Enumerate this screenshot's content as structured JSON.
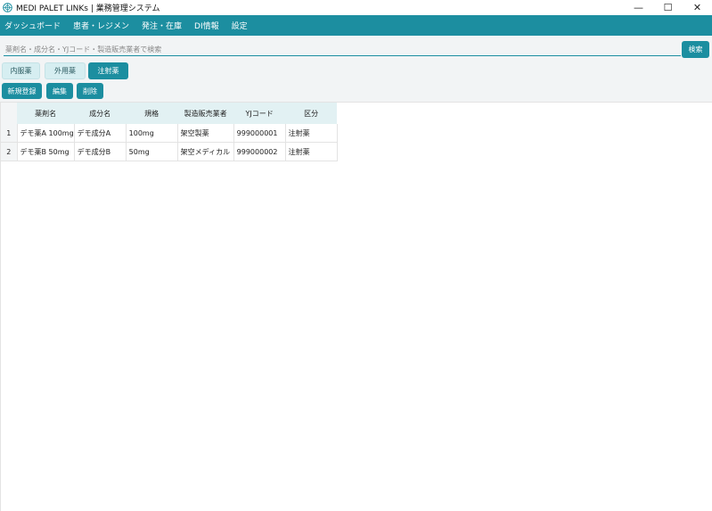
{
  "window": {
    "title": "MEDI PALET LINKs | 業務管理システム",
    "controls": [
      "—",
      "☐",
      "✕"
    ]
  },
  "menu": [
    {
      "label": "ダッシュボード"
    },
    {
      "label": "患者・レジメン"
    },
    {
      "label": "発注・在庫"
    },
    {
      "label": "DI情報"
    },
    {
      "label": "設定"
    }
  ],
  "search": {
    "placeholder": "薬剤名・成分名・YJコード・製造販売業者で検索",
    "value": "",
    "button_label": "検索"
  },
  "categories": [
    {
      "label": "内服薬",
      "active": false
    },
    {
      "label": "外用薬",
      "active": false
    },
    {
      "label": "注射薬",
      "active": true
    }
  ],
  "actions": {
    "new_label": "新規登録",
    "edit_label": "編集",
    "delete_label": "削除"
  },
  "table": {
    "headers": [
      "薬剤名",
      "成分名",
      "規格",
      "製造販売業者",
      "YJコード",
      "区分"
    ],
    "rows": [
      {
        "num": "1",
        "cells": [
          "デモ薬A 100mg",
          "デモ成分A",
          "100mg",
          "架空製薬",
          "999000001",
          "注射薬"
        ]
      },
      {
        "num": "2",
        "cells": [
          "デモ薬B 50mg",
          "デモ成分B",
          "50mg",
          "架空メディカル",
          "999000002",
          "注射薬"
        ]
      }
    ]
  },
  "colors": {
    "accent": "#1c8ea0",
    "inactive_tab": "#d6eef1",
    "header_bg": "#e2f1f3"
  }
}
